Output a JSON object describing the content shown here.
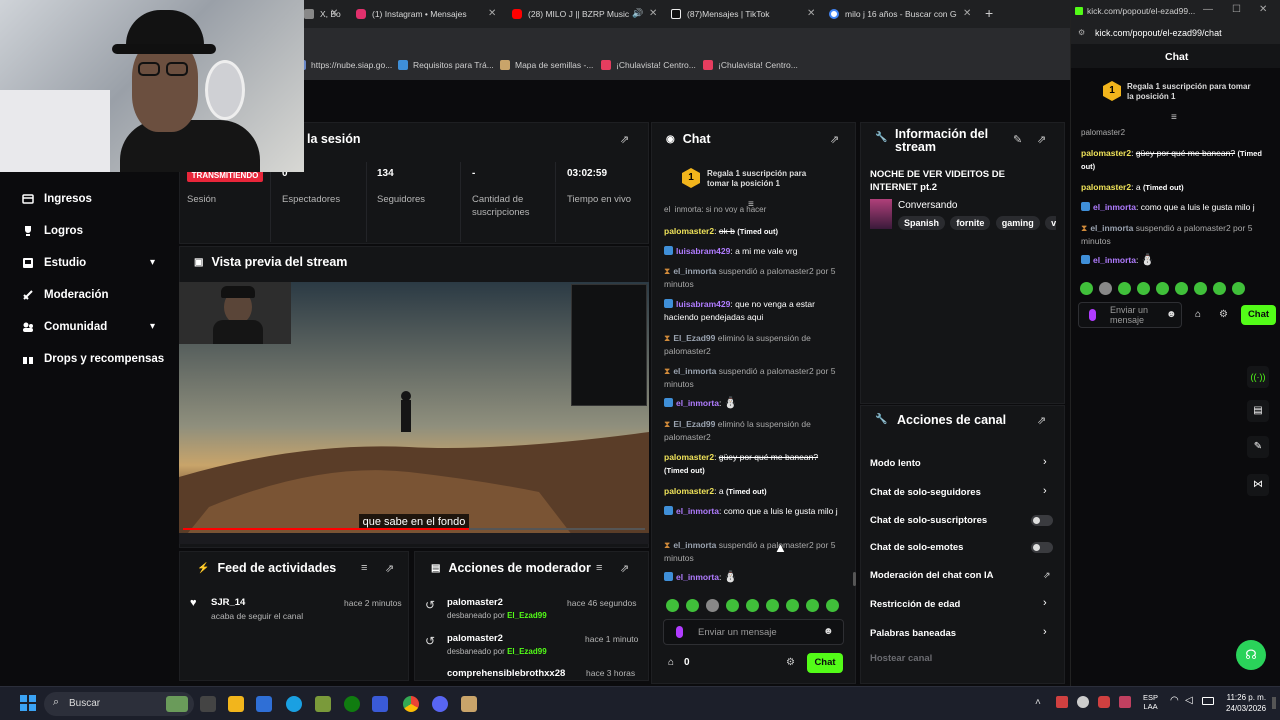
{
  "browser": {
    "tabs": [
      {
        "label": "X, Bo",
        "color": "#888888"
      },
      {
        "label": "(1) Instagram • Mensajes",
        "color": "#e1306c"
      },
      {
        "label": "(28) MILO J || BZRP Music S",
        "color": "#ff0000"
      },
      {
        "label": "(87)Mensajes | TikTok",
        "color": "#ffffff"
      },
      {
        "label": "milo j 16 años - Buscar con Go",
        "color": "#4285f4"
      }
    ],
    "new_tab": "+",
    "bookmarks": [
      {
        "label": "https://nube.siap.go...",
        "color": "#6a88c8"
      },
      {
        "label": "Requisitos para Trá...",
        "color": "#3f8fd8"
      },
      {
        "label": "Mapa de semillas -...",
        "color": "#c9a46a"
      },
      {
        "label": "¡Chulavista! Centro...",
        "color": "#e63d5f"
      },
      {
        "label": "¡Chulavista! Centro...",
        "color": "#e63d5f"
      }
    ]
  },
  "sidebar": {
    "items": [
      {
        "label": "Ingresos"
      },
      {
        "label": "Logros"
      },
      {
        "label": "Estudio",
        "expand": "▾"
      },
      {
        "label": "Moderación"
      },
      {
        "label": "Comunidad",
        "expand": "▾"
      },
      {
        "label": "Drops y recompensas"
      }
    ]
  },
  "session": {
    "title": "la sesión",
    "live_badge": "TRANSMITIENDO",
    "session_label": "Sesión",
    "stats": [
      {
        "value": "0",
        "label": "Espectadores"
      },
      {
        "value": "134",
        "label": "Seguidores"
      },
      {
        "value": "-",
        "label": "Cantidad de suscripciones"
      },
      {
        "value": "03:02:59",
        "label": "Tiempo en vivo"
      }
    ]
  },
  "preview": {
    "title": "Vista previa del stream",
    "subtitle": "que sabe en el fondo"
  },
  "feed": {
    "title": "Feed de actividades",
    "items": [
      {
        "user": "SJR_14",
        "action": "acaba de seguir el canal",
        "time": "hace 2 minutos"
      }
    ]
  },
  "modactions": {
    "title": "Acciones de moderador",
    "items": [
      {
        "user": "palomaster2",
        "action": "desbaneado por",
        "by": "El_Ezad99",
        "time": "hace 46 segundos"
      },
      {
        "user": "palomaster2",
        "action": "desbaneado por",
        "by": "El_Ezad99",
        "time": "hace 1 minuto"
      },
      {
        "user": "comprehensiblebrothxx28",
        "time": "hace 3 horas"
      }
    ]
  },
  "chat": {
    "title": "Chat",
    "gift_text": "Regala 1 suscripción para tomar la posición 1",
    "partial_top": "el_inmorta: si no voy a hacer",
    "messages": [
      {
        "user": "palomaster2",
        "text": "ok b",
        "note": "(Timed out)"
      },
      {
        "user": "luisabram429",
        "text": "a mi me vale vrg"
      },
      {
        "mod": "el_inmorta",
        "text": "suspendió a palomaster2 por 5 minutos"
      },
      {
        "user": "luisabram429",
        "text": "que no venga a estar haciendo pendejadas aqui"
      },
      {
        "mod": "El_Ezad99",
        "text": "eliminó la suspensión de palomaster2"
      },
      {
        "mod": "el_inmorta",
        "text": "suspendió a palomaster2 por 5 minutos"
      },
      {
        "user": "el_inmorta",
        "text": ""
      },
      {
        "mod": "El_Ezad99",
        "text": "eliminó la suspensión de palomaster2"
      },
      {
        "user": "palomaster2",
        "text": "güey por qué me banean?",
        "note": "(Timed out)"
      },
      {
        "user": "palomaster2",
        "text": "a",
        "note": "(Timed out)"
      },
      {
        "user": "el_inmorta",
        "text": "como que a luis le gusta milo j"
      },
      {
        "mod": "el_inmorta",
        "text": "suspendió a palomaster2 por 5 minutos"
      },
      {
        "user": "el_inmorta",
        "text": ""
      }
    ],
    "input_placeholder": "Enviar un mensaje",
    "points": "0",
    "send": "Chat"
  },
  "streaminfo": {
    "title": "Información del stream",
    "stream_title": "NOCHE DE VER VIDEITOS DE INTERNET pt.2",
    "category": "Conversando",
    "tags": [
      "Spanish",
      "fornite",
      "gaming",
      "v"
    ]
  },
  "channel_actions": {
    "title": "Acciones de canal",
    "items": [
      {
        "label": "Modo lento",
        "control": "arrow"
      },
      {
        "label": "Chat de solo-seguidores",
        "control": "arrow"
      },
      {
        "label": "Chat de solo-suscriptores",
        "control": "toggle"
      },
      {
        "label": "Chat de solo-emotes",
        "control": "toggle"
      },
      {
        "label": "Moderación del chat con IA",
        "control": "external"
      },
      {
        "label": "Restricción de edad",
        "control": "arrow"
      },
      {
        "label": "Palabras baneadas",
        "control": "arrow"
      }
    ],
    "faded": "Hostear canal"
  },
  "popout": {
    "url_short": "kick.com/popout/el-ezad99...",
    "url": "kick.com/popout/el-ezad99/chat",
    "title": "Chat",
    "gift_text": "Regala 1 suscripción para tomar la posición 1",
    "first_user": "palomaster2",
    "messages": [
      {
        "user": "palomaster2",
        "text": "güey por qué me banean?",
        "note": "(Timed out)"
      },
      {
        "user": "palomaster2",
        "text": "a",
        "note": "(Timed out)"
      },
      {
        "user": "el_inmorta",
        "text": "como que a luis le gusta milo j"
      },
      {
        "mod": "el_inmorta",
        "text": "suspendió a palomaster2 por 5 minutos"
      },
      {
        "user": "el_inmorta",
        "text": ""
      }
    ],
    "input_placeholder": "Enviar un mensaje",
    "send": "Chat"
  },
  "taskbar": {
    "search": "Buscar",
    "lang1": "ESP",
    "lang2": "LAA",
    "time": "11:26 p. m.",
    "date": "24/03/2026"
  },
  "colors": {
    "accent": "#53fc18",
    "live": "#e8263a",
    "panel": "#141517"
  }
}
